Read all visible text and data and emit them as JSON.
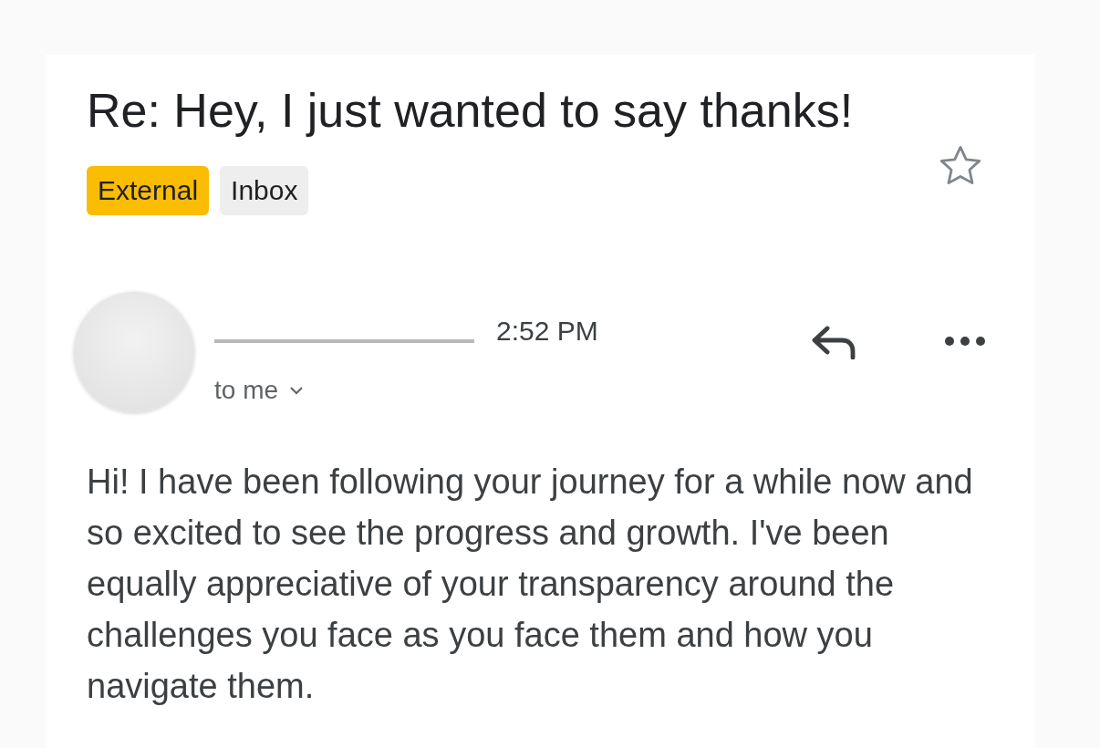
{
  "subject": "Re: Hey, I just wanted to say thanks!",
  "labels": [
    {
      "text": "External",
      "kind": "external"
    },
    {
      "text": "Inbox",
      "kind": "folder"
    }
  ],
  "starred": false,
  "message": {
    "time": "2:52 PM",
    "recipient": "to me",
    "body": "Hi! I have been following your journey for a while now and so excited to see the progress and growth. I've been equally appreciative of your transparency around the challenges you face as you face them and how you navigate them."
  }
}
